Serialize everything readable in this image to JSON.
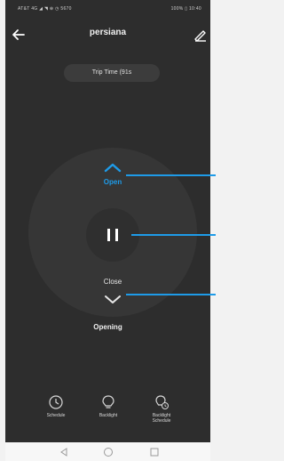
{
  "status_bar": {
    "left_text": "AT&T 4G  ◢ ◥ ⊕ ◷ 5670",
    "right_text": "100% ▯ 10:40"
  },
  "header": {
    "title": "persiana",
    "back_icon": "arrow-left-icon",
    "edit_icon": "pencil-icon"
  },
  "trip_time": {
    "label": "Trip Time (91s"
  },
  "controls": {
    "open_label": "Open",
    "close_label": "Close",
    "state_text": "Opening"
  },
  "bottom_actions": [
    {
      "label": "Schedule",
      "sublabel": "",
      "icon": "clock-icon"
    },
    {
      "label": "Backlight",
      "sublabel": "",
      "icon": "bulb-icon"
    },
    {
      "label": "Backlight",
      "sublabel": "Schedule",
      "icon": "bulb-clock-icon"
    }
  ],
  "nav_bar": {
    "back_icon": "triangle-back-icon",
    "home_icon": "circle-home-icon",
    "recents_icon": "square-recents-icon"
  },
  "colors": {
    "accent": "#1e9be8",
    "background": "#2d2d2d",
    "dial": "#363636"
  }
}
